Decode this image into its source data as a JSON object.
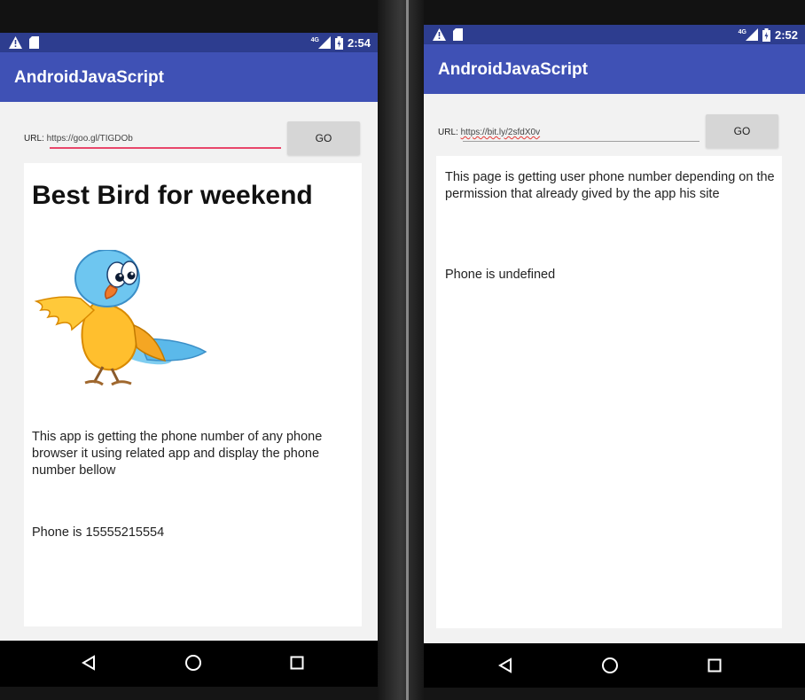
{
  "left_phone": {
    "status": {
      "time": "2:54",
      "network": "4G"
    },
    "app_title": "AndroidJavaScript",
    "url_bar": {
      "label": "URL:",
      "value": "https://goo.gl/TIGDOb",
      "go_label": "GO"
    },
    "page": {
      "heading": "Best Bird for weekend",
      "image": "cartoon-bluebird",
      "paragraph": "This app is getting the phone number of any phone browser it using related app and display the phone number bellow",
      "phone_text": "Phone is 15555215554"
    }
  },
  "right_phone": {
    "status": {
      "time": "2:52",
      "network": "4G"
    },
    "app_title": "AndroidJavaScript",
    "url_bar": {
      "label": "URL:",
      "value": "https://bit.ly/2sfdX0v",
      "go_label": "GO"
    },
    "page": {
      "paragraph": "This page is getting user phone number depending on the permission that already gived by the app his site",
      "phone_text": "Phone is undefined"
    }
  },
  "navigation": [
    "back-icon",
    "home-icon",
    "recents-icon"
  ],
  "colors": {
    "status_bar": "#2d3d8f",
    "app_bar": "#3f51b5",
    "url_underline_active": "#e8466a",
    "url_underline_idle": "#9e9e9e",
    "go_button": "#d6d6d6"
  }
}
